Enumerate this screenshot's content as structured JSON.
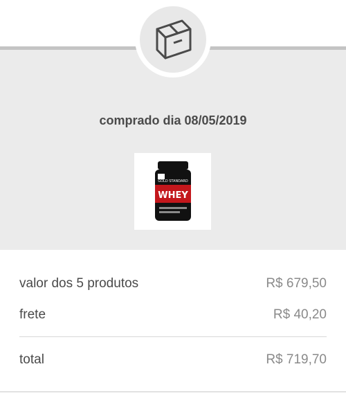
{
  "order": {
    "purchase_date_label": "comprado dia 08/05/2019",
    "product_image_icon": "whey-protein-jar",
    "status_icon": "package-box-icon"
  },
  "summary": {
    "products_label": "valor dos 5 produtos",
    "products_amount": "R$ 679,50",
    "shipping_label": "frete",
    "shipping_amount": "R$ 40,20",
    "total_label": "total",
    "total_amount": "R$ 719,70"
  },
  "product_jar": {
    "brand_line": "GOLD STANDARD",
    "name": "WHEY"
  },
  "colors": {
    "panel": "#ebebeb",
    "text": "#4a4a4a",
    "muted": "#8a8a8a",
    "jar_red": "#c3171c",
    "jar_black": "#111111"
  }
}
